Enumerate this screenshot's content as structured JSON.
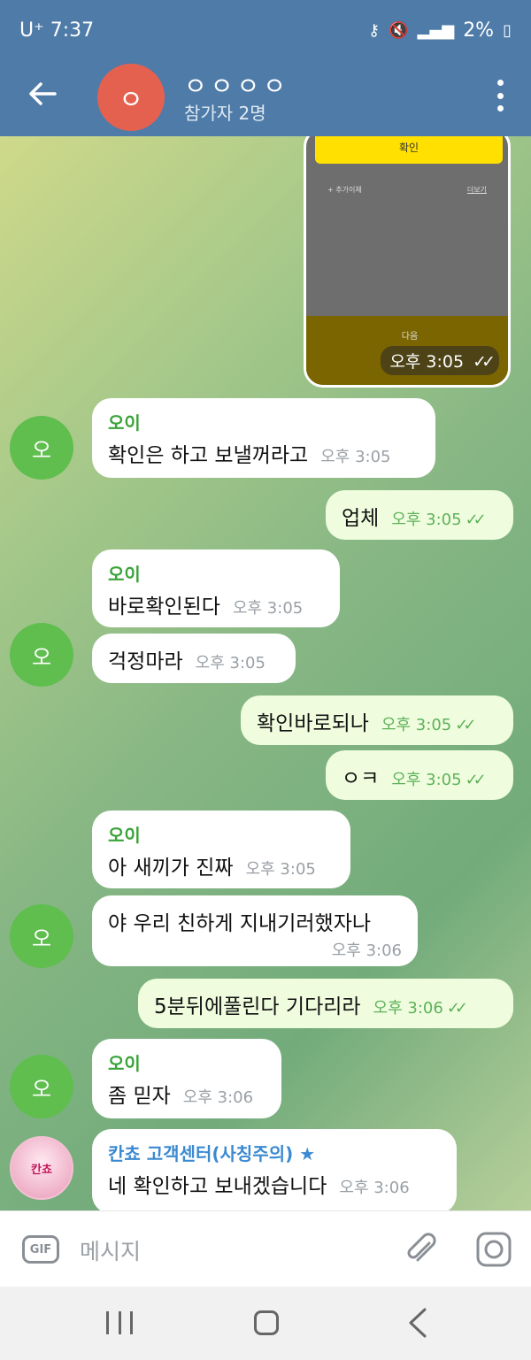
{
  "status_bar": {
    "carrier": "U⁺",
    "time": "7:37",
    "battery": "2%"
  },
  "header": {
    "avatar_letter": "ㅇ",
    "title": "ㅇㅇㅇㅇ",
    "subtitle": "참가자 2명"
  },
  "image_message": {
    "button_label": "확인",
    "small_left": "+ 추가이체",
    "small_right": "더보기",
    "next_label": "다음",
    "time": "오후 3:05"
  },
  "messages": [
    {
      "sender": "오이",
      "text": "확인은 하고 보낼꺼라고",
      "time": "오후 3:05"
    },
    {
      "text": "업체",
      "time": "오후 3:05"
    },
    {
      "sender": "오이",
      "text": "바로확인된다",
      "time": "오후 3:05"
    },
    {
      "text": "걱정마라",
      "time": "오후 3:05"
    },
    {
      "text": "확인바로되나",
      "time": "오후 3:05"
    },
    {
      "text": "ㅇㅋ",
      "time": "오후 3:05"
    },
    {
      "sender": "오이",
      "text": "아 새끼가 진짜",
      "time": "오후 3:05"
    },
    {
      "text": "야 우리 친하게 지내기러했자나",
      "time": "오후 3:06"
    },
    {
      "text": "5분뒤에풀린다 기다리라",
      "time": "오후 3:06"
    },
    {
      "sender": "오이",
      "text": "좀 믿자",
      "time": "오후 3:06"
    },
    {
      "sender": "칸쵸 고객센터(사칭주의) ★",
      "text": "네 확인하고 보내겠습니다",
      "time": "오후 3:06"
    }
  ],
  "avatars": {
    "oi": "오",
    "kancho": "칸쵸"
  },
  "input": {
    "gif_label": "GIF",
    "placeholder": "메시지"
  },
  "colors": {
    "header": "#4f7ba8",
    "outgoing": "#effdde",
    "incoming": "#ffffff",
    "sender_green": "#3aa339",
    "sender_blue": "#3b8ad1"
  }
}
